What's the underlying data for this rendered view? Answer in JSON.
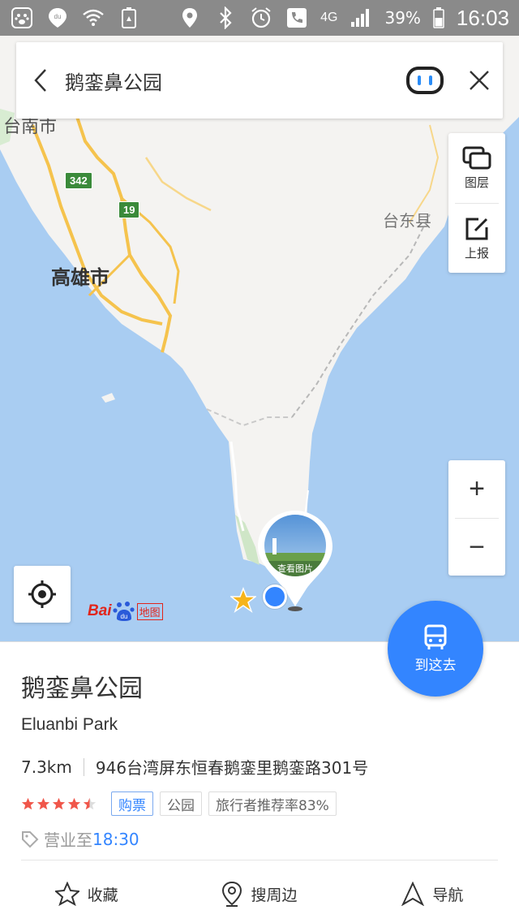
{
  "status_bar": {
    "network": "4G",
    "battery": "39%",
    "time": "16:03"
  },
  "search": {
    "query": "鹅銮鼻公园"
  },
  "map": {
    "labels": {
      "kaohsiung": "高雄市",
      "taitung": "台东县",
      "tainan": "台南市"
    },
    "road_shields": [
      "342",
      "19"
    ],
    "tools": {
      "layers_label": "图层",
      "report_label": "上报"
    },
    "zoom_in": "+",
    "zoom_out": "−",
    "photo_caption": "查看图片",
    "logo": {
      "bai": "Bai",
      "du": "du",
      "map_text": "地图"
    },
    "accent_color": "#3385ff"
  },
  "goto_button": {
    "label": "到这去"
  },
  "poi": {
    "name": "鹅銮鼻公园",
    "english_name": "Eluanbi Park",
    "distance": "7.3km",
    "address": "946台湾屏东恒春鹅銮里鹅銮路301号",
    "rating": 4.5,
    "tags": [
      "购票",
      "公园",
      "旅行者推荐率83%"
    ],
    "hours_prefix": "营业至",
    "hours_time": "18:30"
  },
  "actions": {
    "favorite": "收藏",
    "nearby": "搜周边",
    "navigate": "导航"
  }
}
